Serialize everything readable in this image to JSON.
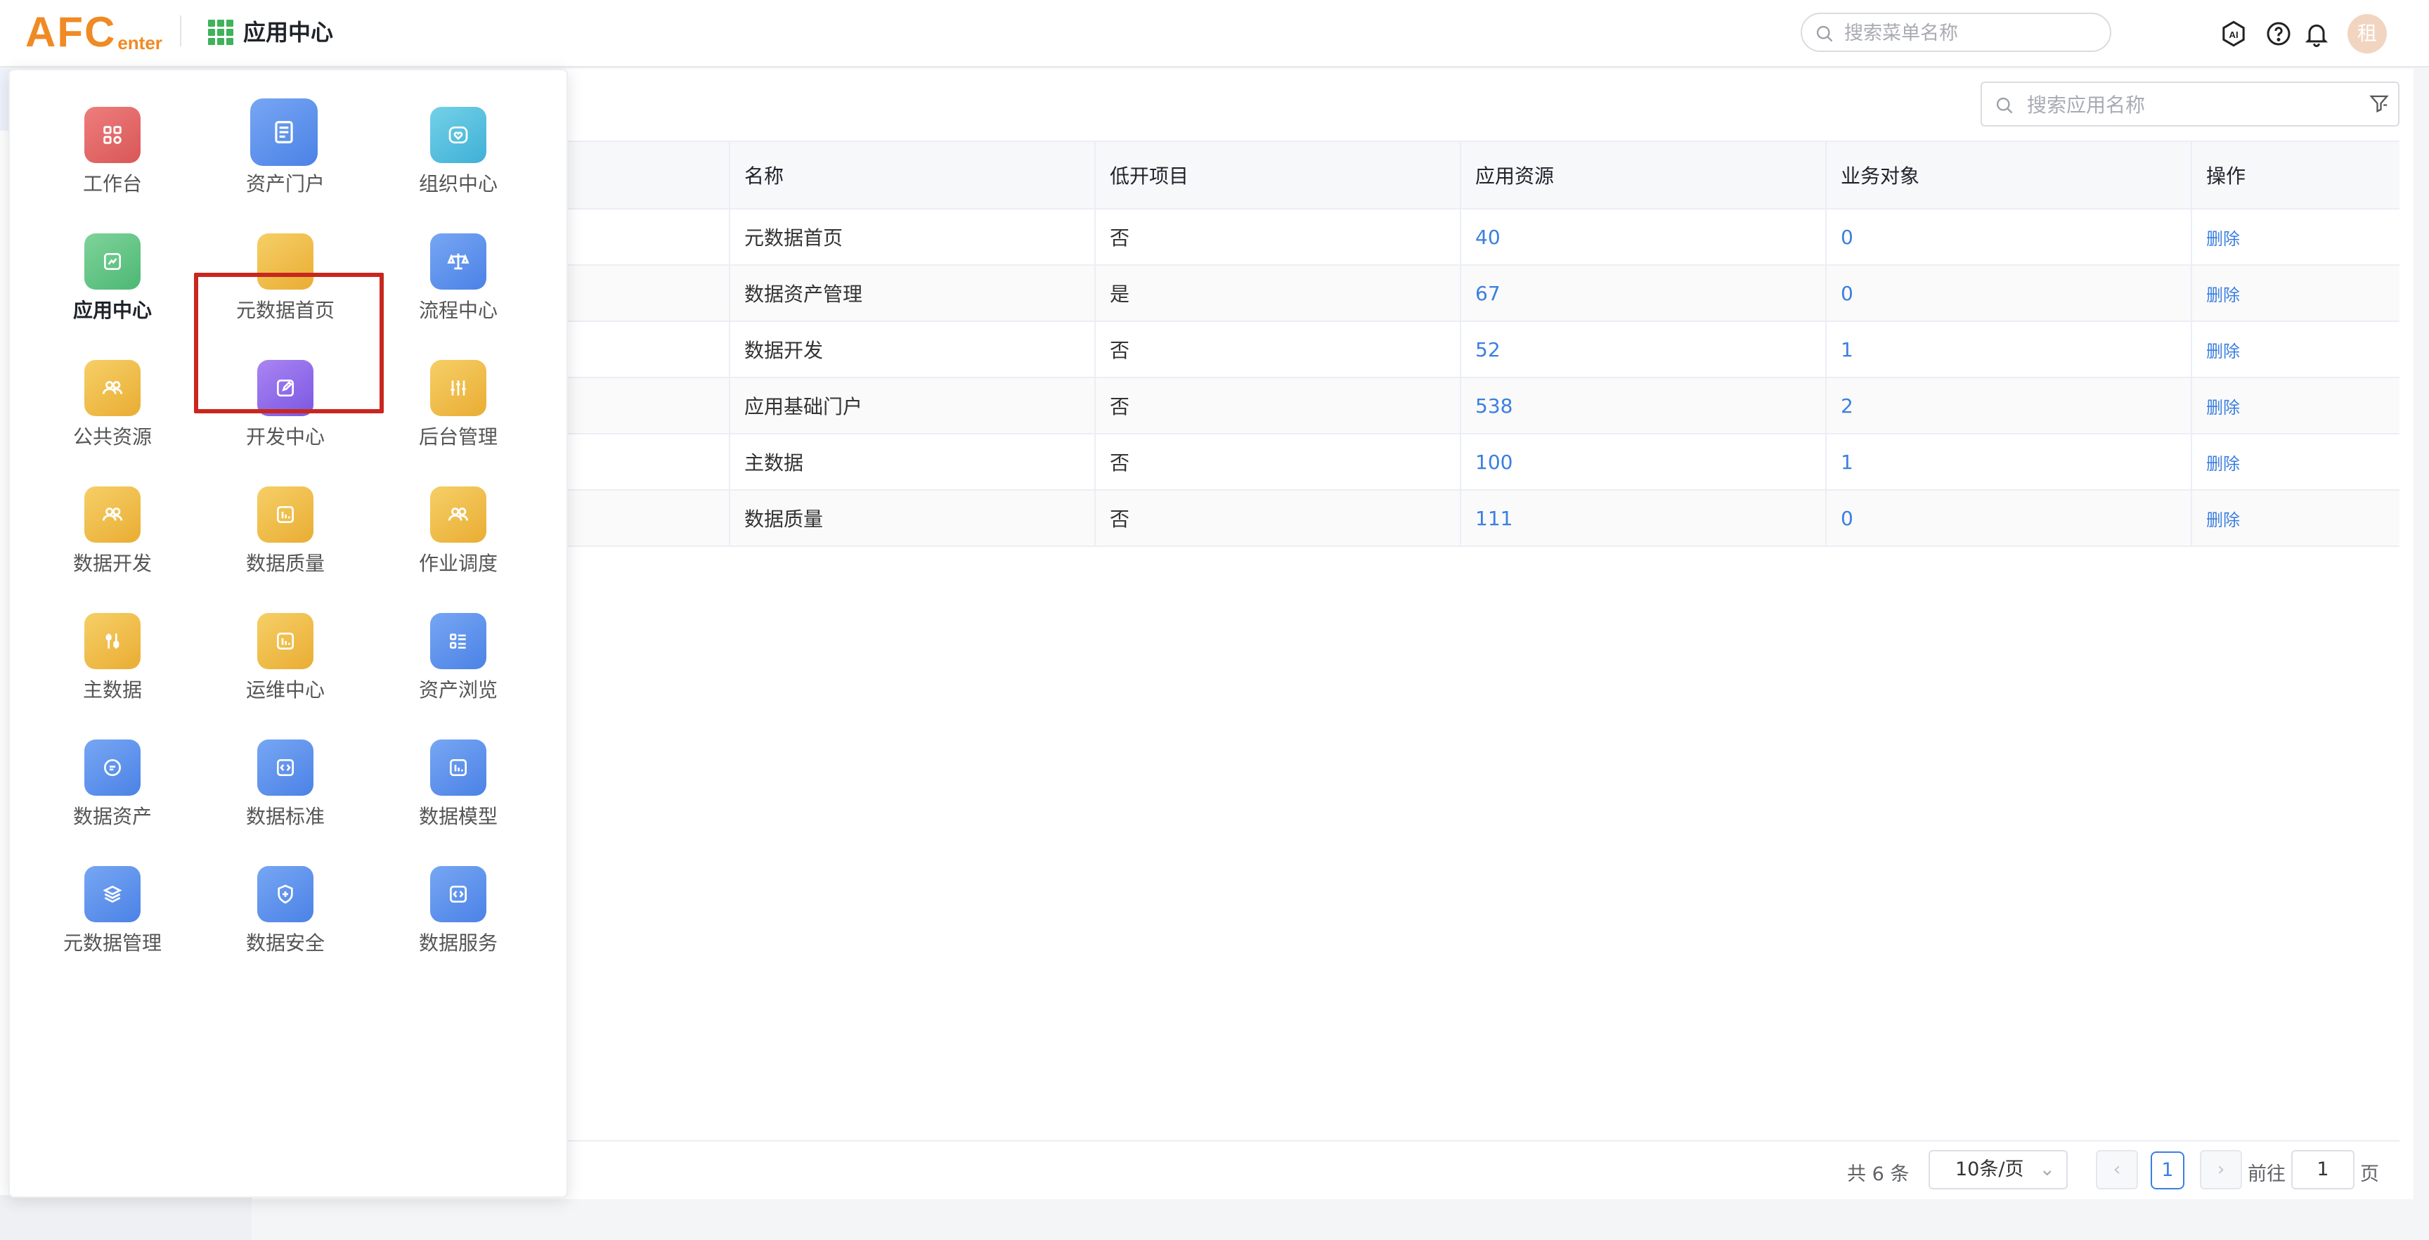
{
  "header": {
    "logo_main": "AFC",
    "logo_sub": "enter",
    "app_title": "应用中心",
    "menu_search_placeholder": "搜索菜单名称",
    "avatar_text": "租"
  },
  "launcher": {
    "items": [
      {
        "label": "工作台",
        "icon": "apps-icon",
        "color": "red"
      },
      {
        "label": "资产门户",
        "icon": "document-icon",
        "color": "blue"
      },
      {
        "label": "组织中心",
        "icon": "heart-icon",
        "color": "cyan"
      },
      {
        "label": "应用中心",
        "icon": "chart-icon",
        "color": "green"
      },
      {
        "label": "元数据首页",
        "icon": "",
        "color": "yellow"
      },
      {
        "label": "流程中心",
        "icon": "scale-icon",
        "color": "blue"
      },
      {
        "label": "公共资源",
        "icon": "users-icon",
        "color": "yellow"
      },
      {
        "label": "开发中心",
        "icon": "edit-icon",
        "color": "purple"
      },
      {
        "label": "后台管理",
        "icon": "sliders-icon",
        "color": "yellow"
      },
      {
        "label": "数据开发",
        "icon": "users-icon",
        "color": "yellow"
      },
      {
        "label": "数据质量",
        "icon": "bar-chart-icon",
        "color": "yellow"
      },
      {
        "label": "作业调度",
        "icon": "users-icon",
        "color": "yellow"
      },
      {
        "label": "主数据",
        "icon": "tools-icon",
        "color": "yellow"
      },
      {
        "label": "运维中心",
        "icon": "bar-chart-icon",
        "color": "yellow"
      },
      {
        "label": "资产浏览",
        "icon": "list-icon",
        "color": "blue"
      },
      {
        "label": "数据资产",
        "icon": "chat-icon",
        "color": "blue"
      },
      {
        "label": "数据标准",
        "icon": "code-icon",
        "color": "blue"
      },
      {
        "label": "数据模型",
        "icon": "bar-chart-icon",
        "color": "blue"
      },
      {
        "label": "元数据管理",
        "icon": "layers-icon",
        "color": "blue"
      },
      {
        "label": "数据安全",
        "icon": "shield-icon",
        "color": "blue"
      },
      {
        "label": "数据服务",
        "icon": "code-icon",
        "color": "blue"
      }
    ]
  },
  "search": {
    "placeholder": "搜索应用名称"
  },
  "table": {
    "columns": [
      "名称",
      "低开项目",
      "应用资源",
      "业务对象",
      "操作"
    ],
    "rows": [
      {
        "name": "元数据首页",
        "lowcode": "否",
        "resources": "40",
        "objects": "0",
        "action": "删除"
      },
      {
        "name": "数据资产管理",
        "lowcode": "是",
        "resources": "67",
        "objects": "0",
        "action": "删除"
      },
      {
        "name": "数据开发",
        "lowcode": "否",
        "resources": "52",
        "objects": "1",
        "action": "删除"
      },
      {
        "name": "应用基础门户",
        "lowcode": "否",
        "resources": "538",
        "objects": "2",
        "action": "删除"
      },
      {
        "name": "主数据",
        "lowcode": "否",
        "resources": "100",
        "objects": "1",
        "action": "删除"
      },
      {
        "name": "数据质量",
        "lowcode": "否",
        "resources": "111",
        "objects": "0",
        "action": "删除"
      }
    ]
  },
  "pagination": {
    "total": "共 6 条",
    "page_size": "10条/页",
    "current_page": "1",
    "goto_label": "前往",
    "goto_value": "1",
    "page_unit": "页"
  }
}
